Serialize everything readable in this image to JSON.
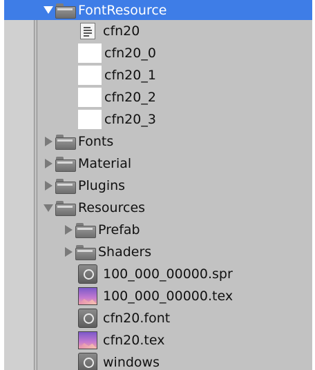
{
  "colors": {
    "panel_bg": "#c2c2c2",
    "selection": "#3e7de7"
  },
  "tree": [
    {
      "label": "FontResource",
      "icon": "folder-icon",
      "expanded": true,
      "selected": true
    },
    {
      "label": "cfn20",
      "icon": "font-doc-icon"
    },
    {
      "label": "cfn20_0",
      "icon": "blank-texture-icon"
    },
    {
      "label": "cfn20_1",
      "icon": "blank-texture-icon"
    },
    {
      "label": "cfn20_2",
      "icon": "blank-texture-icon"
    },
    {
      "label": "cfn20_3",
      "icon": "blank-texture-icon"
    },
    {
      "label": "Fonts",
      "icon": "folder-icon",
      "expanded": false
    },
    {
      "label": "Material",
      "icon": "folder-icon",
      "expanded": false
    },
    {
      "label": "Plugins",
      "icon": "folder-icon",
      "expanded": false
    },
    {
      "label": "Resources",
      "icon": "folder-icon",
      "expanded": true
    },
    {
      "label": "Prefab",
      "icon": "folder-icon",
      "expanded": false
    },
    {
      "label": "Shaders",
      "icon": "folder-icon",
      "expanded": false
    },
    {
      "label": "100_000_00000.spr",
      "icon": "unity-asset-icon"
    },
    {
      "label": "100_000_00000.tex",
      "icon": "texture-icon"
    },
    {
      "label": "cfn20.font",
      "icon": "unity-asset-icon"
    },
    {
      "label": "cfn20.tex",
      "icon": "texture-icon"
    },
    {
      "label": "windows",
      "icon": "unity-asset-icon"
    }
  ]
}
